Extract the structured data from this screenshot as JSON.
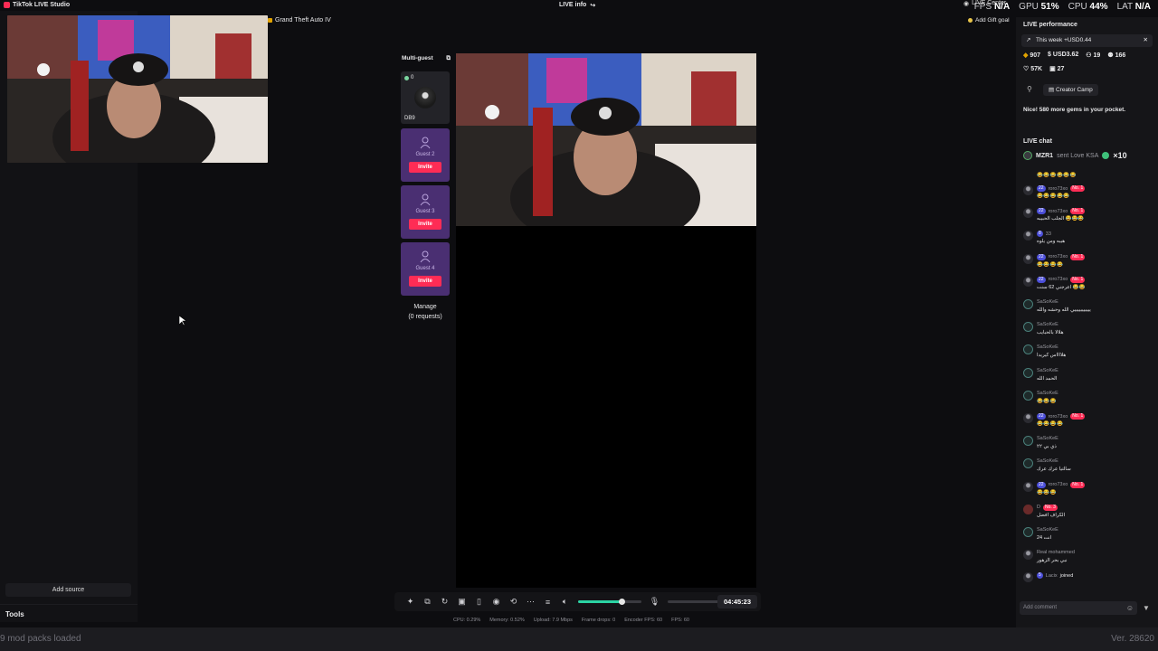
{
  "app": {
    "title": "TikTok LIVE Studio",
    "live_info": "LIVE info",
    "live_center": "LIVE Center",
    "stats": [
      {
        "label": "FPS",
        "value": "N/A"
      },
      {
        "label": "GPU",
        "value": "51%"
      },
      {
        "label": "CPU",
        "value": "44%"
      },
      {
        "label": "LAT",
        "value": "N/A"
      }
    ],
    "add_gift_goal": "Add Gift goal"
  },
  "left": {
    "game_tag": "Grand Theft Auto IV",
    "add_source": "Add source",
    "tools": "Tools"
  },
  "multiguest": {
    "title": "Multi-guest",
    "host": {
      "gems": "0",
      "name": "DB9"
    },
    "guests": [
      {
        "label": "Guest 2",
        "invite": "Invite"
      },
      {
        "label": "Guest 3",
        "invite": "Invite"
      },
      {
        "label": "Guest 4",
        "invite": "Invite"
      }
    ],
    "manage_line1": "Manage",
    "manage_line2": "(0 requests)"
  },
  "controls": {
    "volume_level": 0.68,
    "mic_level": 0.0,
    "timer": "04:45:23",
    "status": [
      "CPU: 0.29%",
      "Memory: 0.52%",
      "Upload: 7.9 Mbps",
      "Frame drops: 0",
      "Encoder FPS: 60",
      "FPS: 60"
    ]
  },
  "bottom": {
    "left": "9 mod packs loaded",
    "right": "Ver. 28620"
  },
  "performance": {
    "title": "LIVE performance",
    "week": "This week +USD0.44",
    "metrics_row1": [
      "907",
      "USD3.62",
      "19",
      "166"
    ],
    "metrics_row2": [
      "57K",
      "27"
    ],
    "camp": "Creator Camp",
    "nice": "Nice! 580 more gems in your pocket."
  },
  "chat": {
    "title": "LIVE chat",
    "gift": {
      "user": "MZR1",
      "text": "sent Love KSA",
      "count": "×10"
    },
    "messages": [
      {
        "user": "",
        "level": "",
        "no": "",
        "text": "😂😂😂😂😂😂",
        "avatar": "none"
      },
      {
        "user": "roro73xo",
        "level": "22",
        "no": "No. 1",
        "text": "😂😂😂😂😂",
        "avatar": "img"
      },
      {
        "user": "roro73xo",
        "level": "22",
        "no": "No. 1",
        "text": "الجلب الحبيبه 😂😂😂",
        "avatar": "img"
      },
      {
        "user": "33",
        "level": "8",
        "no": "",
        "text": "هيبه ومن يلوه",
        "avatar": "photo"
      },
      {
        "user": "roro73xo",
        "level": "22",
        "no": "No. 1",
        "text": "😂😂😂😂",
        "avatar": "img"
      },
      {
        "user": "roro73xo",
        "level": "22",
        "no": "No. 1",
        "text": "اعرجني 62 سنت 😂😂",
        "avatar": "img"
      },
      {
        "user": "SaSoKeE",
        "level": "",
        "no": "",
        "text": "يييييييييييي الله وحشه والله",
        "avatar": "check"
      },
      {
        "user": "SaSoKeE",
        "level": "",
        "no": "",
        "text": "هلالا بالحبايب",
        "avatar": "check"
      },
      {
        "user": "SaSoKeE",
        "level": "",
        "no": "",
        "text": "هلااااس كيريدا",
        "avatar": "check"
      },
      {
        "user": "SaSoKeE",
        "level": "",
        "no": "",
        "text": "الحمد الله",
        "avatar": "check"
      },
      {
        "user": "SaSoKeE",
        "level": "",
        "no": "",
        "text": "😂😂😂",
        "avatar": "check"
      },
      {
        "user": "roro73xo",
        "level": "22",
        "no": "No. 1",
        "text": "😂😂😂😂",
        "avatar": "img"
      },
      {
        "user": "SaSoKeE",
        "level": "",
        "no": "",
        "text": "ذي بي ٢٢",
        "avatar": "check"
      },
      {
        "user": "SaSoKeE",
        "level": "",
        "no": "",
        "text": "سالتيا عرك عرك",
        "avatar": "check"
      },
      {
        "user": "roro73xo",
        "level": "22",
        "no": "No. 1",
        "text": "😂😂😂",
        "avatar": "img"
      },
      {
        "user": "D",
        "level": "",
        "no": "No. 3",
        "text": "الكراف افضل",
        "avatar": "red"
      },
      {
        "user": "SaSoKeE",
        "level": "",
        "no": "",
        "text": "انت 24",
        "avatar": "check"
      },
      {
        "user": "Real mohammed",
        "level": "",
        "no": "",
        "text": "نبي بحر الزهور",
        "avatar": "photo"
      },
      {
        "user": "Lacix",
        "level": "5",
        "no": "",
        "text": "joined",
        "avatar": "img",
        "inline": true
      }
    ],
    "comment_placeholder": "Add comment"
  }
}
